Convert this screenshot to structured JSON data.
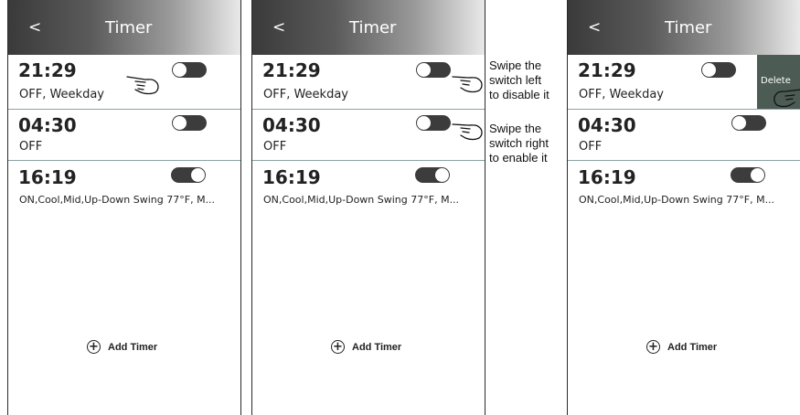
{
  "screens": [
    {
      "back_label": "<",
      "title": "Timer",
      "timers": [
        {
          "time": "21:29",
          "details": "OFF,  Weekday",
          "enabled": false
        },
        {
          "time": "04:30",
          "details": "OFF",
          "enabled": false
        },
        {
          "time": "16:19",
          "details": "ON,Cool,Mid,Up-Down Swing 77°F, M...",
          "enabled": true
        }
      ],
      "add_label": "Add Timer"
    },
    {
      "back_label": "<",
      "title": "Timer",
      "timers": [
        {
          "time": "21:29",
          "details": "OFF,  Weekday",
          "enabled": false
        },
        {
          "time": "04:30",
          "details": "OFF",
          "enabled": false
        },
        {
          "time": "16:19",
          "details": "ON,Cool,Mid,Up-Down Swing 77°F, M...",
          "enabled": true
        }
      ],
      "add_label": "Add Timer"
    },
    {
      "back_label": "<",
      "title": "Timer",
      "timers": [
        {
          "time": "21:29",
          "details": "OFF,  Weekday",
          "enabled": false
        },
        {
          "time": "04:30",
          "details": "OFF",
          "enabled": false
        },
        {
          "time": "16:19",
          "details": "ON,Cool,Mid,Up-Down Swing 77°F, M...",
          "enabled": true
        }
      ],
      "add_label": "Add Timer",
      "delete_label": "Delete"
    }
  ],
  "annotations": {
    "disable": [
      "Swipe the",
      "switch left",
      "to disable it"
    ],
    "enable": [
      "Swipe the",
      "switch right",
      "to enable it"
    ]
  },
  "icons": [
    "back-icon",
    "hand-pointer-icon",
    "add-circle-icon"
  ],
  "colors": {
    "header_dark": "#3a3a3a",
    "toggle": "#3c3c3c",
    "delete_bg": "#4c5c55",
    "divider": "#8aa3a5"
  }
}
